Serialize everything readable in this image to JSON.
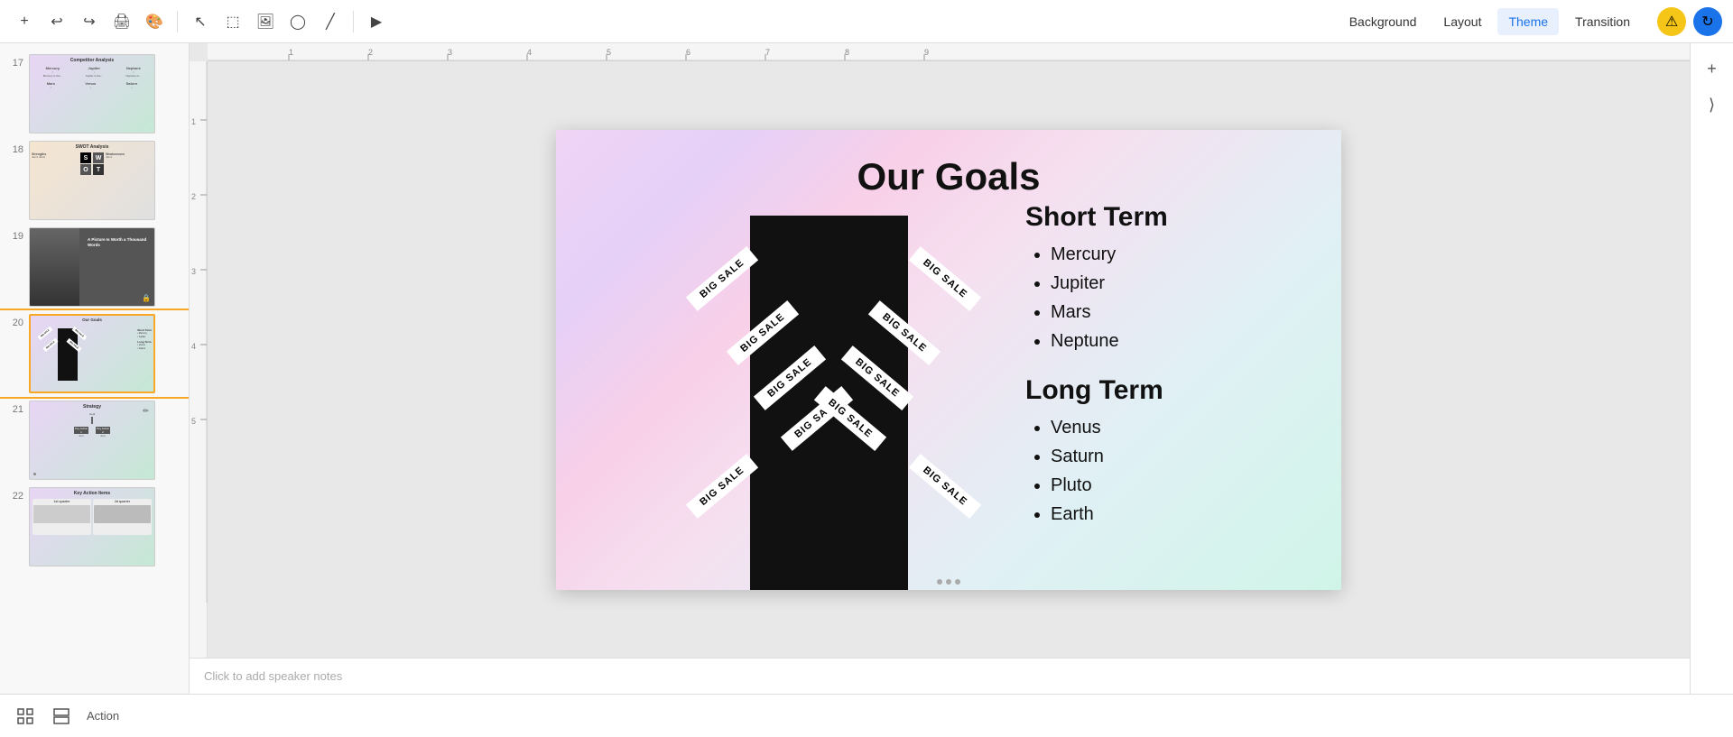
{
  "toolbar": {
    "add_label": "+",
    "undo_label": "↩",
    "redo_label": "↪",
    "print_label": "🖨",
    "paint_label": "🎨",
    "cursor_label": "↖",
    "text_label": "T",
    "image_label": "🖼",
    "shape_label": "◯",
    "line_label": "╱",
    "menu_items": [
      {
        "label": "Background",
        "active": false
      },
      {
        "label": "Layout",
        "active": false
      },
      {
        "label": "Theme",
        "active": true
      },
      {
        "label": "Transition",
        "active": false
      }
    ]
  },
  "slide_panel": {
    "slides": [
      {
        "number": "17",
        "label": "Competitor Analysis"
      },
      {
        "number": "18",
        "label": "SWOT Analysis"
      },
      {
        "number": "19",
        "label": "A Picture Is Worth a Thousand Words"
      },
      {
        "number": "20",
        "label": "Our Goals",
        "active": true
      },
      {
        "number": "21",
        "label": "Strategy"
      },
      {
        "number": "22",
        "label": "Key Action Items"
      }
    ]
  },
  "slide": {
    "title": "Our Goals",
    "short_term": {
      "heading": "Short Term",
      "items": [
        "Mercury",
        "Jupiter",
        "Mars",
        "Neptune"
      ]
    },
    "long_term": {
      "heading": "Long Term",
      "items": [
        "Venus",
        "Saturn",
        "Pluto",
        "Earth"
      ]
    },
    "banners": [
      "BIG SALE",
      "BIG SALE",
      "BIG SALE",
      "BIG SALE",
      "BIG SALE",
      "BIG SALE",
      "BIG SALE",
      "BIG SALE",
      "BIG SALE",
      "BIG SALE"
    ]
  },
  "notes": {
    "placeholder": "Click to add speaker notes"
  },
  "bottom_bar": {
    "action_label": "Action"
  },
  "right_panel": {
    "add_icon": "+",
    "expand_icon": "⟩"
  }
}
